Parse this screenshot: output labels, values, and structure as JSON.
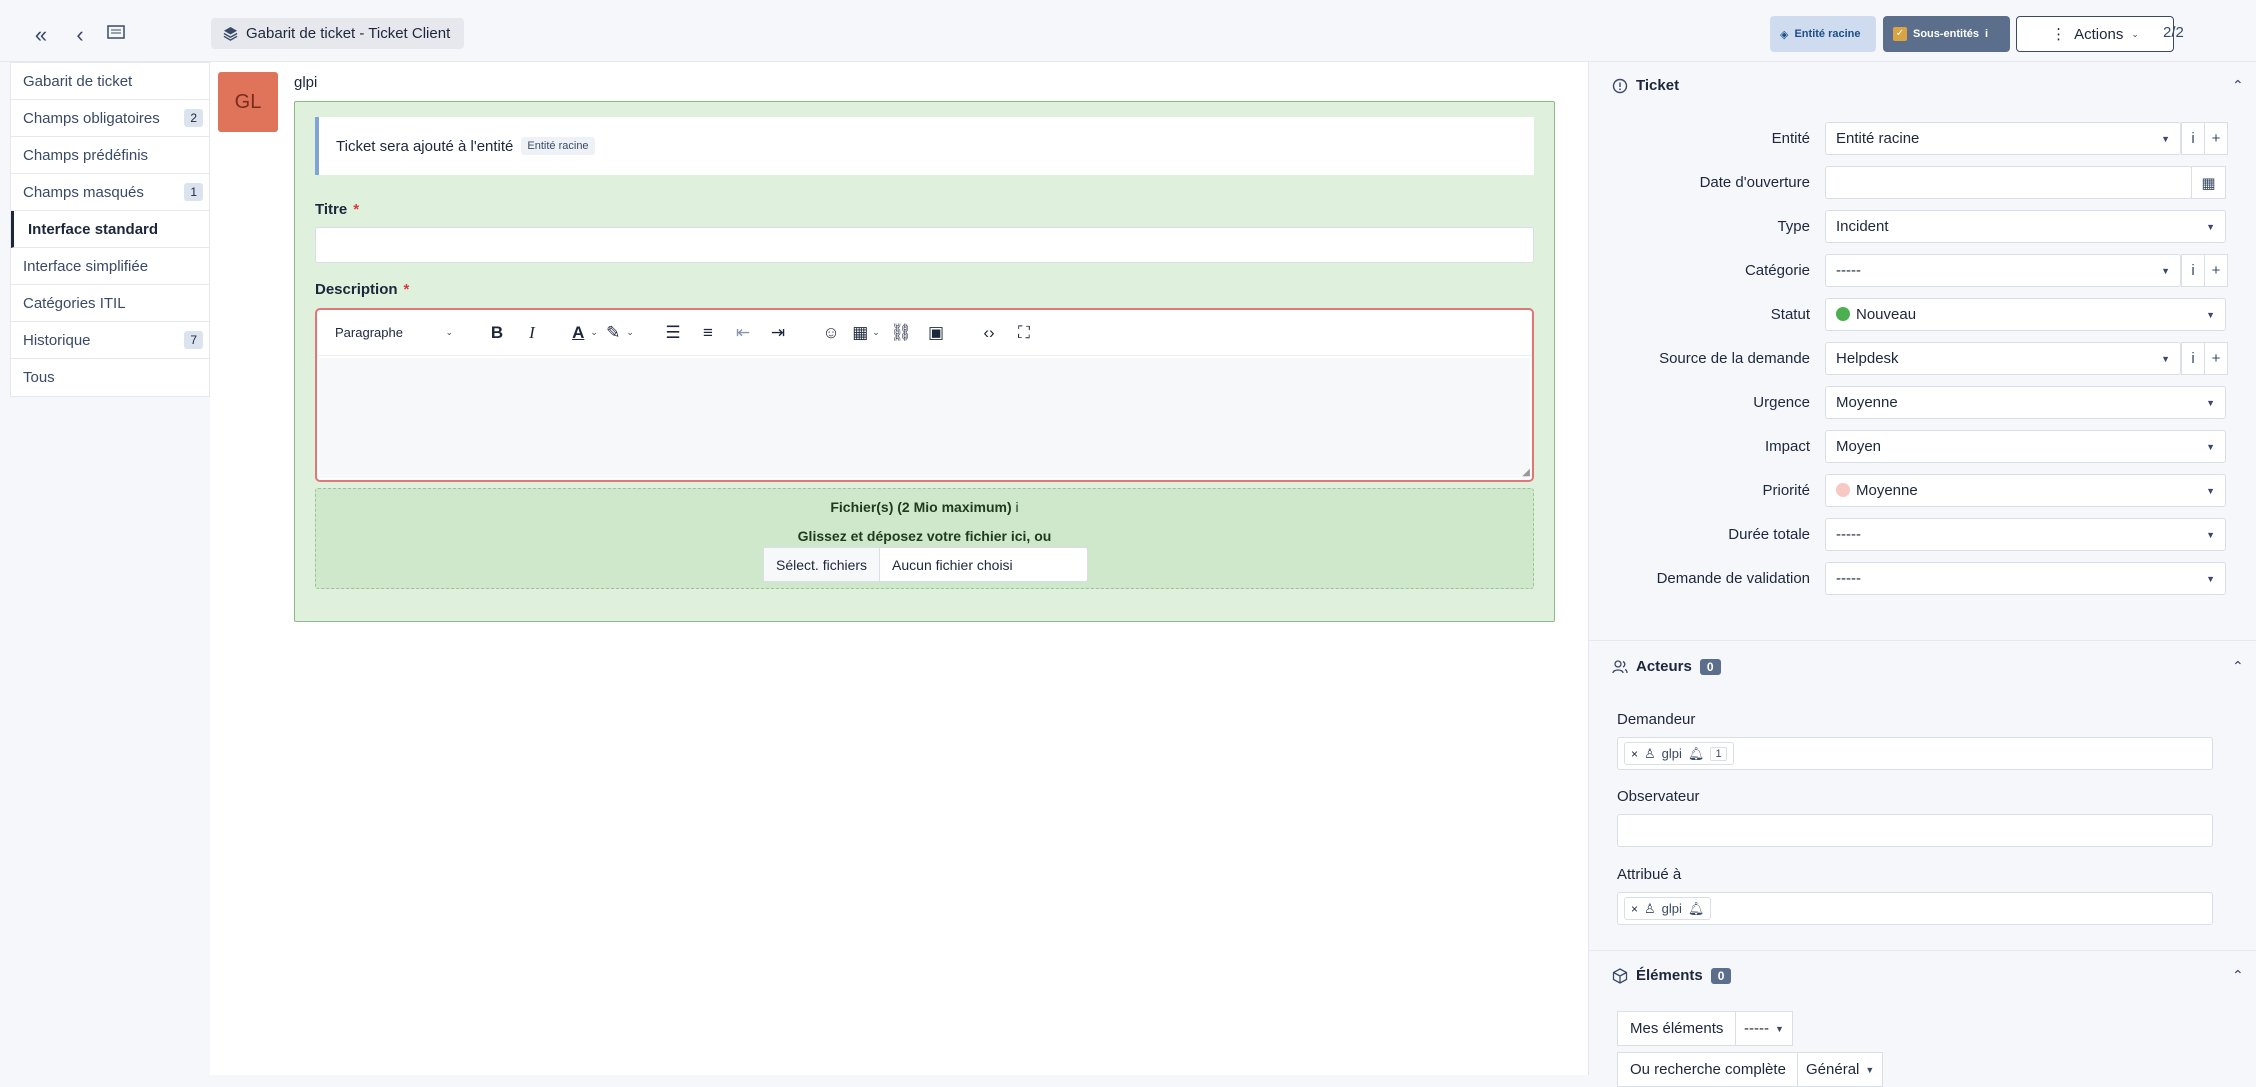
{
  "header": {
    "breadcrumb": "Gabarit de ticket - Ticket Client",
    "entity_root_label": "Entité racine",
    "subentities_label": "Sous-entités",
    "actions_label": "Actions",
    "pager": "2/2"
  },
  "sidebar": {
    "items": [
      {
        "label": "Gabarit de ticket",
        "badge": ""
      },
      {
        "label": "Champs obligatoires",
        "badge": "2"
      },
      {
        "label": "Champs prédéfinis",
        "badge": ""
      },
      {
        "label": "Champs masqués",
        "badge": "1"
      },
      {
        "label": "Interface standard",
        "badge": "",
        "active": true
      },
      {
        "label": "Interface simplifiée",
        "badge": ""
      },
      {
        "label": "Catégories ITIL",
        "badge": ""
      },
      {
        "label": "Historique",
        "badge": "7"
      },
      {
        "label": "Tous",
        "badge": ""
      }
    ]
  },
  "main": {
    "avatar_initials": "GL",
    "author": "glpi",
    "notice_text": "Ticket sera ajouté à l'entité",
    "notice_badge": "Entité racine",
    "title_label": "Titre",
    "required_mark": "*",
    "description_label": "Description",
    "editor": {
      "paragraph_select": "Paragraphe"
    },
    "files": {
      "title": "Fichier(s) (2 Mio maximum)",
      "info": "i",
      "drop_text": "Glissez et déposez votre fichier ici, ou",
      "button_label": "Sélect. fichiers",
      "no_file": "Aucun fichier choisi"
    }
  },
  "right_panel": {
    "ticket_section": {
      "title": "Ticket",
      "fields": [
        {
          "label": "Entité",
          "value": "Entité racine"
        },
        {
          "label": "Date d'ouverture",
          "value": ""
        },
        {
          "label": "Type",
          "value": "Incident"
        },
        {
          "label": "Catégorie",
          "value": "-----"
        },
        {
          "label": "Statut",
          "value": "Nouveau"
        },
        {
          "label": "Source de la demande",
          "value": "Helpdesk"
        },
        {
          "label": "Urgence",
          "value": "Moyenne"
        },
        {
          "label": "Impact",
          "value": "Moyen"
        },
        {
          "label": "Priorité",
          "value": "Moyenne"
        },
        {
          "label": "Durée totale",
          "value": "-----"
        },
        {
          "label": "Demande de validation",
          "value": "-----"
        }
      ]
    },
    "actors_section": {
      "title": "Acteurs",
      "count": "0",
      "requester_label": "Demandeur",
      "requester_chip": "glpi",
      "requester_chip_count": "1",
      "observer_label": "Observateur",
      "assigned_label": "Attribué à",
      "assigned_chip": "glpi"
    },
    "elements_section": {
      "title": "Éléments",
      "count": "0",
      "my_elements": "Mes éléments",
      "my_elements_value": "-----",
      "full_search": "Ou recherche complète",
      "full_search_value": "Général"
    }
  },
  "colors": {
    "status_new": "#4caf50",
    "priority_medium": "#f8c8c4",
    "accent": "#5b6f8c"
  }
}
